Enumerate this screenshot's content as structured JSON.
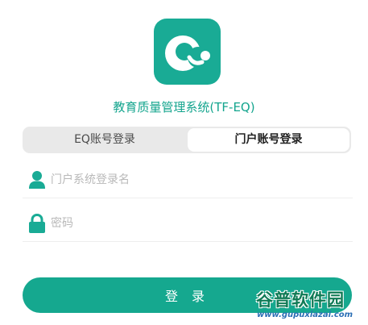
{
  "app": {
    "title": "教育质量管理系统(TF-EQ)",
    "logo_icon": "q-logo-icon",
    "brand_color": "#19ab95"
  },
  "tabs": [
    {
      "label": "EQ账号登录",
      "selected": false
    },
    {
      "label": "门户账号登录",
      "selected": true
    }
  ],
  "form": {
    "username": {
      "icon": "user-icon",
      "value": "",
      "placeholder": "门户系统登录名"
    },
    "password": {
      "icon": "lock-icon",
      "value": "",
      "placeholder": "密码"
    },
    "login_label": "登 录"
  },
  "watermark": {
    "title": "谷普软件园",
    "url": "www.gupuxiazai.com"
  }
}
